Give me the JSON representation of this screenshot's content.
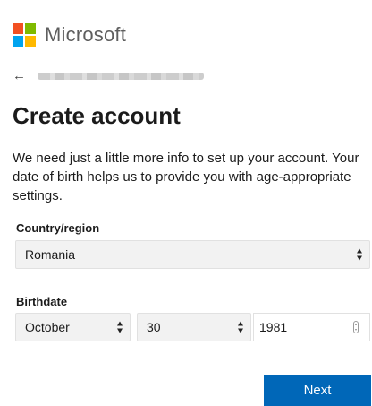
{
  "brand": {
    "name": "Microsoft",
    "logo_colors": [
      "#f25022",
      "#7fba00",
      "#00a4ef",
      "#ffb900"
    ]
  },
  "identity": {
    "back_icon": "arrow-left-icon",
    "redacted": true
  },
  "heading": {
    "title": "Create account",
    "description": "We need just a little more info to set up your account. Your date of birth helps us to provide you with age-appropriate settings."
  },
  "country": {
    "label": "Country/region",
    "selected": "Romania"
  },
  "birthdate": {
    "label": "Birthdate",
    "month": "October",
    "day": "30",
    "year": "1981"
  },
  "actions": {
    "next_label": "Next"
  },
  "colors": {
    "primary_button": "#0067b8",
    "field_background": "#f2f2f2"
  }
}
